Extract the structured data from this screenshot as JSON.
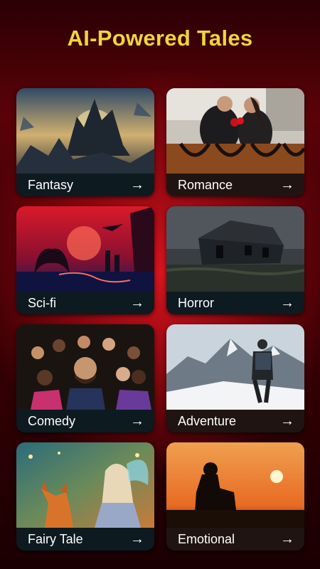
{
  "page": {
    "title": "AI-Powered Tales"
  },
  "cards": [
    {
      "label": "Fantasy",
      "arrow": "→"
    },
    {
      "label": "Romance",
      "arrow": "→"
    },
    {
      "label": "Sci-fi",
      "arrow": "→"
    },
    {
      "label": "Horror",
      "arrow": "→"
    },
    {
      "label": "Comedy",
      "arrow": "→"
    },
    {
      "label": "Adventure",
      "arrow": "→"
    },
    {
      "label": "Fairy Tale",
      "arrow": "→"
    },
    {
      "label": "Emotional",
      "arrow": "→"
    }
  ],
  "icons": {
    "arrow": "arrow-right-icon"
  }
}
